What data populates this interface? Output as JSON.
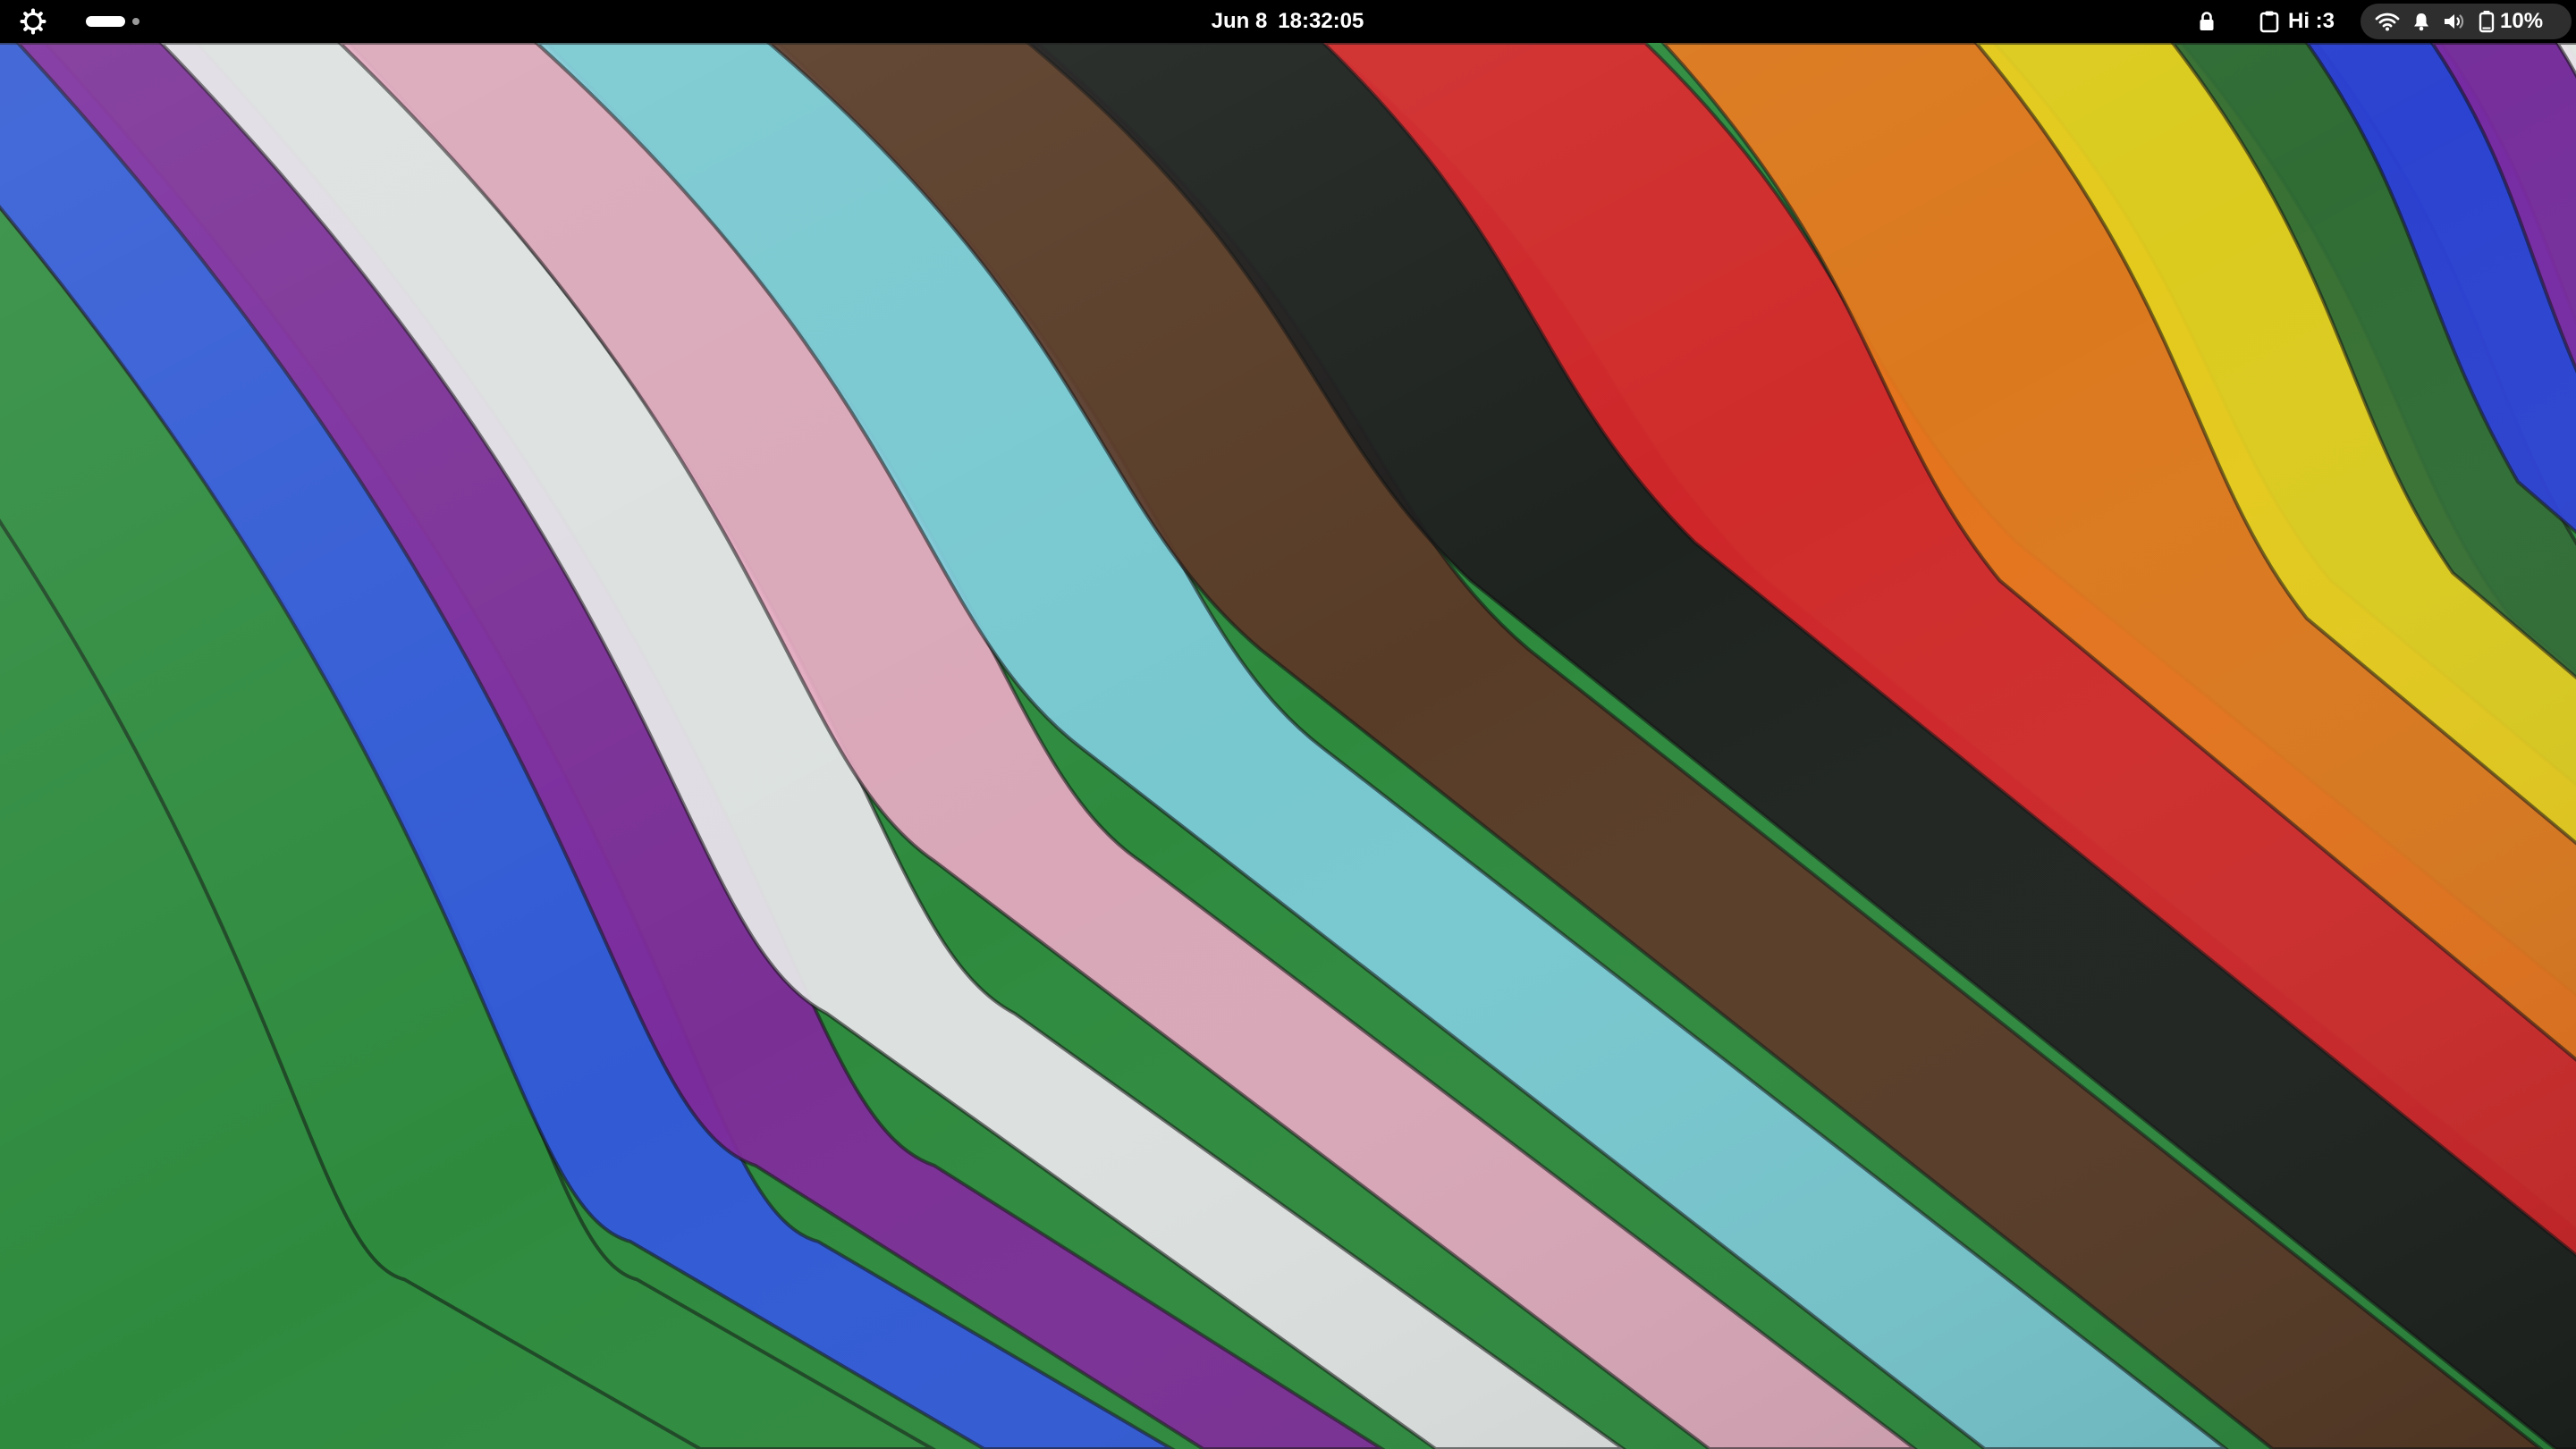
{
  "topbar": {
    "activities_icon": "gear-icon",
    "workspaces": {
      "count": 2,
      "active_index": 0
    },
    "clock": {
      "date": "Jun 8",
      "time": "18:32:05"
    },
    "indicators": {
      "lock_icon": "lock-icon",
      "clipboard_icon": "clipboard-icon",
      "clipboard_text": "Hi :3",
      "wifi_icon": "wifi-icon",
      "notification_icon": "bell-icon",
      "volume_icon": "speaker-icon",
      "battery_icon": "battery-icon",
      "battery_percent": "10%"
    },
    "colors": {
      "bar": "#000000",
      "text": "#ffffff",
      "status_pill": "#2e2e2e"
    }
  },
  "wallpaper": {
    "description_colors": [
      "#2e8b3e",
      "#3257dc",
      "#7e2a9a",
      "#e6e6e8",
      "#e3a9bf",
      "#7ccbd8",
      "#5b3826",
      "#1e1e1e",
      "#d8272a",
      "#e5781c",
      "#e5cf1e",
      "#2f6b35",
      "#2b3fd8",
      "#7a2aa0",
      "#ececec"
    ]
  }
}
